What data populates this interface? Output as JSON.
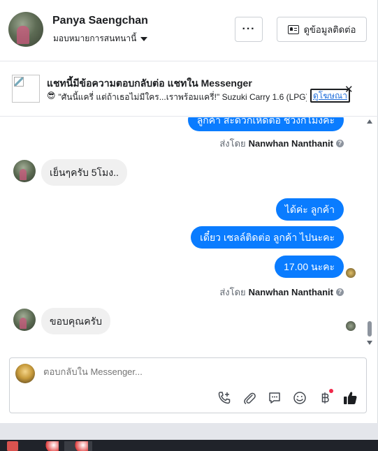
{
  "header": {
    "name": "Panya Saengchan",
    "subtitle": "มอบหมายการสนทนานี้",
    "more_label": "···",
    "contact_label": "ดูข้อมูลติดต่อ"
  },
  "ad": {
    "title": "แชทนี้มีข้อความตอบกลับต่อ แชทใน Messenger",
    "emoji": "😎",
    "snippet": "\"ศันนี้แครี่ แต่ถ้าเธอไม่มีใคร...เราพร้อมแครี่!\" Suzuki Carry 1.6 (LPG) ...",
    "link_label": "ดูโฆษณา",
    "close_label": "✕"
  },
  "messages": [
    {
      "side": "out",
      "text": "ลูกค้า สะดวกเห็ดต่อ ช่วงกี่โมงคะ"
    },
    {
      "side": "meta",
      "sent_by_prefix": "ส่งโดย",
      "sent_by_name": "Nanwhan Nanthanit"
    },
    {
      "side": "in",
      "text": "เย็นๆครับ 5โมง.."
    },
    {
      "side": "out",
      "text": "ได้ค่ะ  ลูกค้า"
    },
    {
      "side": "out",
      "text": "เดี๋ยว เซลล์ติดต่อ ลูกค้า ไปนะคะ"
    },
    {
      "side": "out",
      "text": "17.00 นะคะ"
    },
    {
      "side": "meta",
      "sent_by_prefix": "ส่งโดย",
      "sent_by_name": "Nanwhan Nanthanit"
    },
    {
      "side": "in",
      "text": "ขอบคุณครับ"
    }
  ],
  "composer": {
    "placeholder": "ตอบกลับใน Messenger...",
    "icons": [
      "phone-plus-icon",
      "paperclip-icon",
      "chat-bubble-icon",
      "emoji-icon",
      "baht-icon",
      "thumbs-up-icon"
    ],
    "like_color": "#1c1e21"
  },
  "colors": {
    "outgoing_bubble": "#0a7cff",
    "incoming_bubble": "#f0f0f0"
  }
}
